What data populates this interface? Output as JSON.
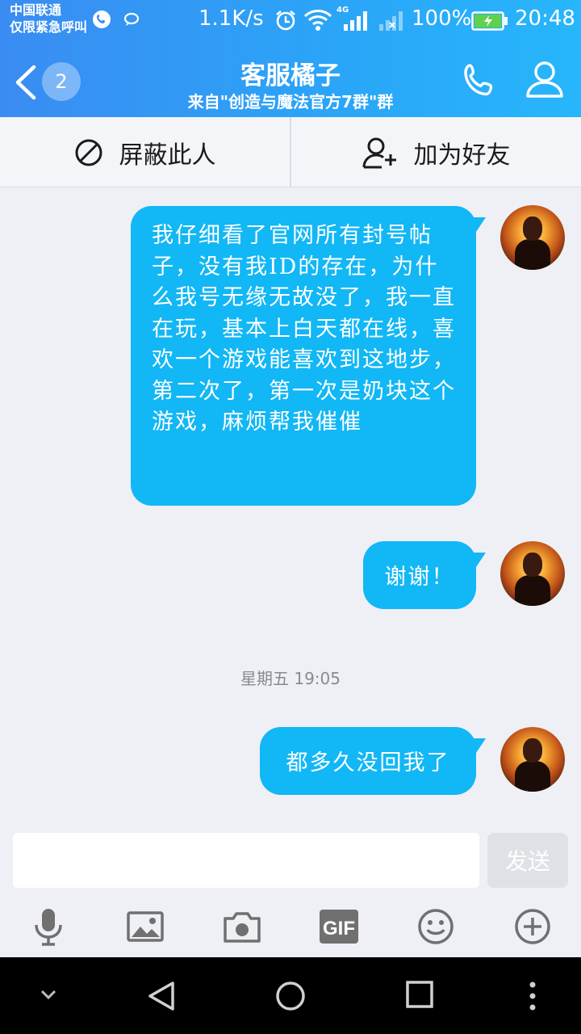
{
  "status_bar": {
    "carrier_line1": "中国联通",
    "carrier_line2": "仅限紧急呼叫",
    "net_speed": "1.1K/s",
    "network_label": "4G",
    "battery_percent": "100%",
    "time": "20:48"
  },
  "header": {
    "unread_count": "2",
    "title": "客服橘子",
    "subtitle": "来自\"创造与魔法官方7群\"群"
  },
  "actions": {
    "block_label": "屏蔽此人",
    "add_friend_label": "加为好友"
  },
  "messages": [
    {
      "text": "我仔细看了官网所有封号帖子，没有我ID的存在，为什么我号无缘无故没了，我一直在玩，基本上白天都在线，喜欢一个游戏能喜欢到这地步，第二次了，第一次是奶块这个游戏，麻烦帮我催催"
    },
    {
      "text": "谢谢！"
    },
    {
      "text": "都多久没回我了"
    }
  ],
  "timestamp": "星期五 19:05",
  "composer": {
    "input_value": "",
    "send_label": "发送"
  },
  "toolbar": {
    "gif_label": "GIF"
  },
  "colors": {
    "header_start": "#3a8cf2",
    "header_end": "#27b6fb",
    "bubble": "#12b7f5",
    "background": "#eef0f6"
  }
}
